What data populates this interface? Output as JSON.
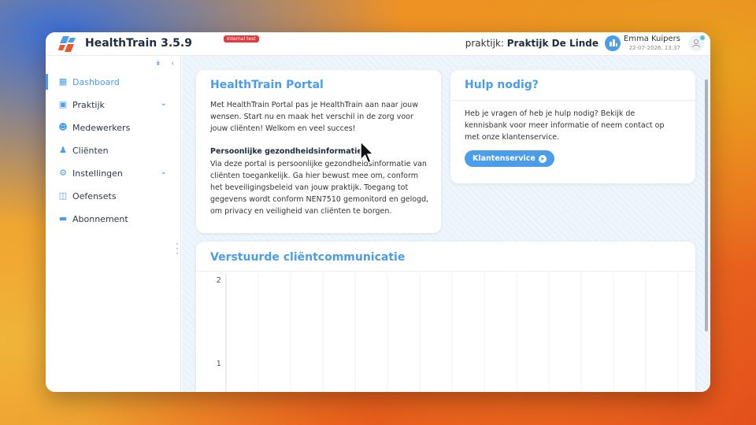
{
  "app": {
    "title": "HealthTrain 3.5.9",
    "env_badge": "Internal test"
  },
  "header": {
    "practice_label": "praktijk:",
    "practice_name": "Praktijk De Linde",
    "user_name": "Emma Kuipers",
    "user_datetime": "22-07-2026, 13:37"
  },
  "sidebar": {
    "items": [
      {
        "label": "Dashboard",
        "icon": "dashboard-icon",
        "active": true
      },
      {
        "label": "Praktijk",
        "icon": "store-icon",
        "expandable": true
      },
      {
        "label": "Medewerkers",
        "icon": "users-icon"
      },
      {
        "label": "Cliënten",
        "icon": "people-icon"
      },
      {
        "label": "Instellingen",
        "icon": "gear-icon",
        "expandable": true
      },
      {
        "label": "Oefensets",
        "icon": "folder-icon"
      },
      {
        "label": "Abonnement",
        "icon": "card-icon"
      }
    ]
  },
  "portal_card": {
    "title": "HealthTrain Portal",
    "intro": "Met HealthTrain Portal pas je HealthTrain aan naar jouw wensen. Start nu en maak het verschil in de zorg voor jouw cliënten! Welkom en veel succes!",
    "sub_title": "Persoonlijke gezondheidsinformatie",
    "sub_text": "Via deze portal is persoonlijke gezondheidsinformatie van cliënten toegankelijk. Ga hier bewust mee om, conform het beveiligingsbeleid van jouw praktijk. Toegang tot gegevens wordt conform NEN7510 gemonitord en gelogd, om privacy en veiligheid van cliënten te borgen."
  },
  "help_card": {
    "title": "Hulp nodig?",
    "text": "Heb je vragen of heb je hulp nodig? Bekijk de kennisbank voor meer informatie of neem contact op met onze klantenservice.",
    "button_label": "Klantenservice"
  },
  "chart_card": {
    "title": "Verstuurde cliëntcommunicatie"
  },
  "chart_data": {
    "type": "bar",
    "title": "Verstuurde cliëntcommunicatie",
    "y_ticks": [
      "2",
      "1"
    ],
    "ylim": [
      0,
      2
    ],
    "grid": true,
    "categories": [],
    "values": []
  },
  "colors": {
    "accent": "#4a9de8",
    "badge": "#e03a3a"
  }
}
